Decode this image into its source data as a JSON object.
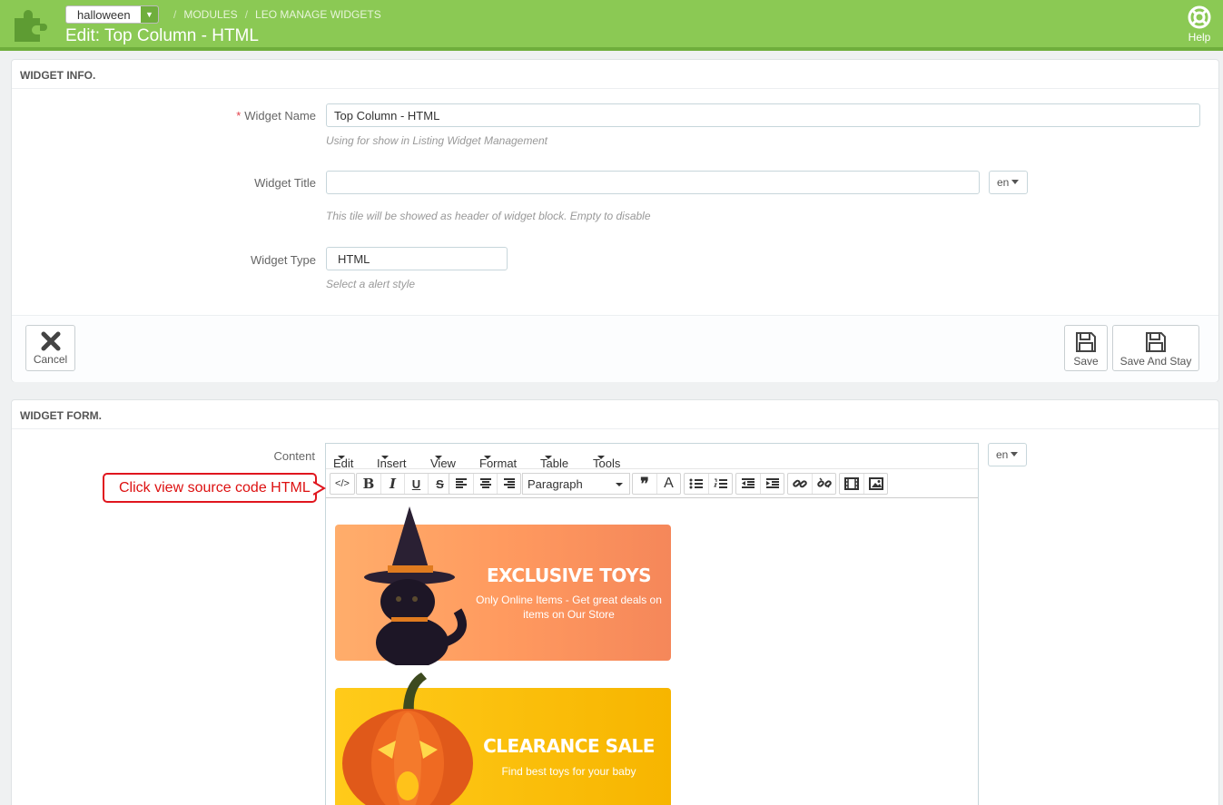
{
  "header": {
    "shop": "halloween",
    "crumbs": [
      "MODULES",
      "LEO MANAGE WIDGETS"
    ],
    "title": "Edit: Top Column - HTML",
    "help": "Help"
  },
  "widget_info": {
    "heading": "WIDGET INFO.",
    "name_label": "Widget Name",
    "name_value": "Top Column - HTML",
    "name_help": "Using for show in Listing Widget Management",
    "title_label": "Widget Title",
    "title_value": "",
    "title_help": "This tile will be showed as header of widget block. Empty to disable",
    "lang": "en",
    "type_label": "Widget Type",
    "type_value": "HTML",
    "type_help": "Select a alert style",
    "cancel": "Cancel",
    "save": "Save",
    "save_stay": "Save And Stay"
  },
  "widget_form": {
    "heading": "WIDGET FORM.",
    "content_label": "Content",
    "lang": "en",
    "menu": [
      "Edit",
      "Insert",
      "View",
      "Format",
      "Table",
      "Tools"
    ],
    "format_value": "Paragraph",
    "callout": "Click view source code HTML",
    "banner1_title": "EXCLUSIVE TOYS",
    "banner1_sub": "Only Online Items - Get great deals on items on Our Store",
    "banner2_title": "CLEARANCE SALE",
    "banner2_sub": "Find best toys for your baby"
  },
  "colors": {
    "header": "#8bc954",
    "accent_red": "#e0161e"
  }
}
